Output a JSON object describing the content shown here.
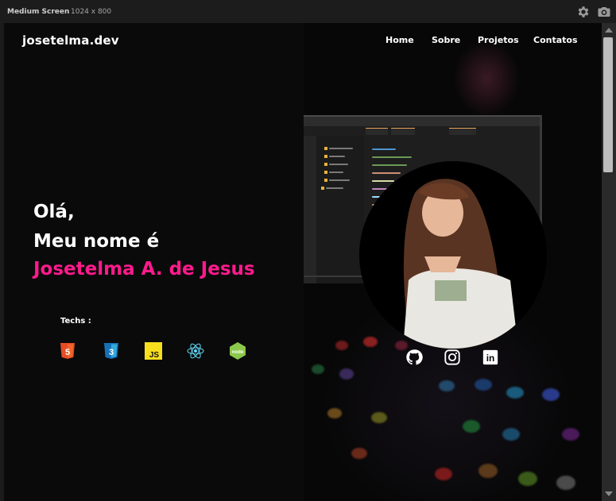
{
  "devtools": {
    "label": "Medium Screen",
    "dimensions": "1024 x 800",
    "icons": [
      "gear-icon",
      "camera-icon"
    ]
  },
  "header": {
    "logo": "josetelma.dev",
    "nav": [
      {
        "label": "Home"
      },
      {
        "label": "Sobre"
      },
      {
        "label": "Projetos"
      },
      {
        "label": "Contatos"
      }
    ]
  },
  "hero": {
    "greeting": "Olá,",
    "intro": "Meu nome é",
    "name": "Josetelma A. de Jesus",
    "techs_label": "Techs :",
    "techs": [
      {
        "icon": "html5-icon",
        "text": "5",
        "color": "#e44d26"
      },
      {
        "icon": "css3-icon",
        "text": "3",
        "color": "#1572b6"
      },
      {
        "icon": "javascript-icon",
        "text": "JS",
        "color": "#f7df1e"
      },
      {
        "icon": "react-icon",
        "text": "",
        "color": "#61dafb"
      },
      {
        "icon": "nodejs-icon",
        "text": "node",
        "color": "#8cc84b"
      }
    ],
    "social": [
      {
        "icon": "github-icon"
      },
      {
        "icon": "instagram-icon"
      },
      {
        "icon": "linkedin-icon",
        "text": "in"
      }
    ]
  },
  "colors": {
    "accent": "#ff1a8c",
    "background": "#0a0a0a",
    "text": "#ffffff"
  }
}
